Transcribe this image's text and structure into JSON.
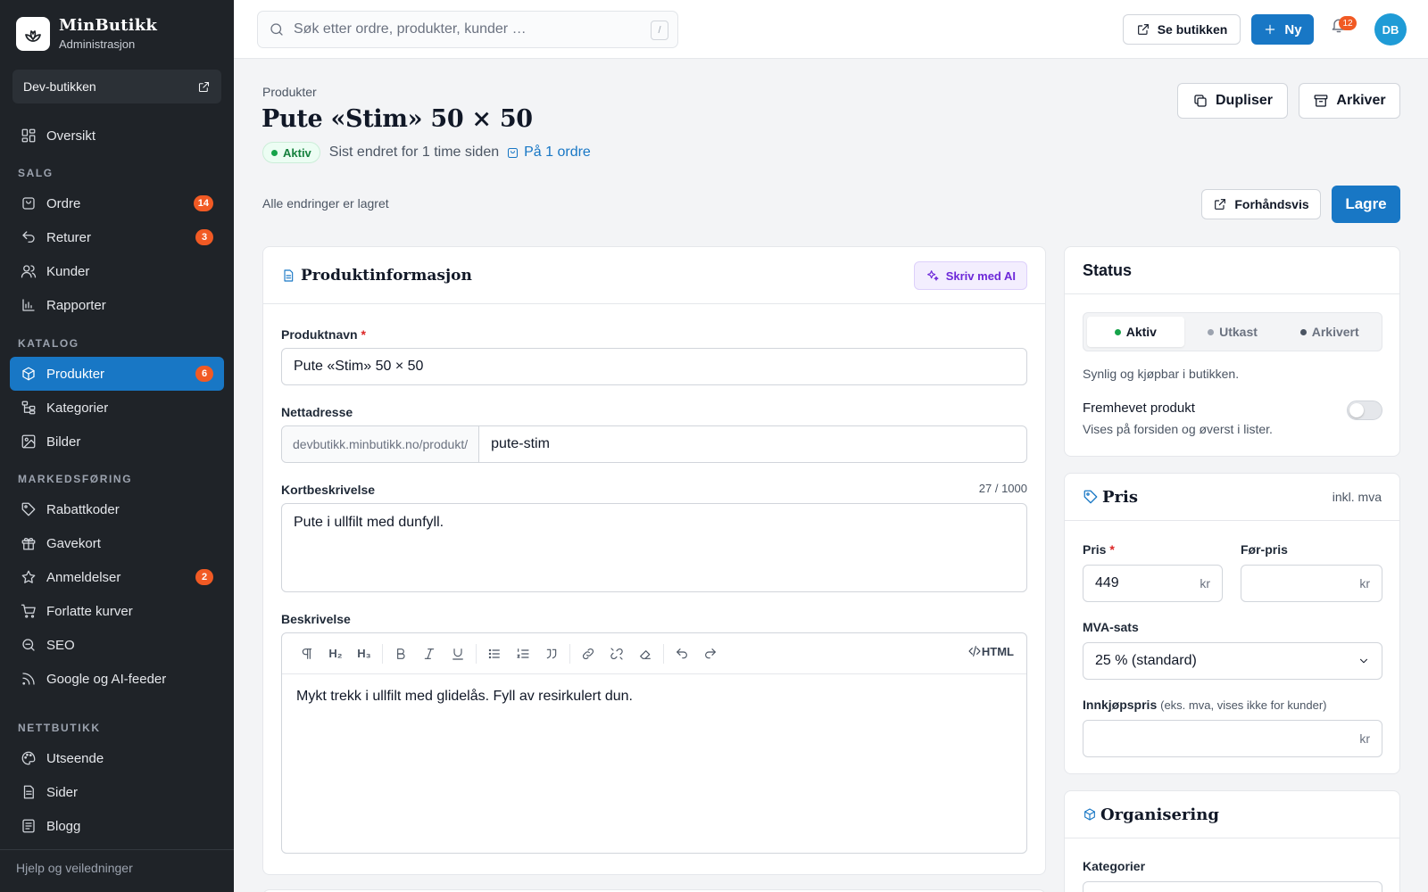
{
  "brand": {
    "name": "MinButikk",
    "subtitle": "Administrasjon"
  },
  "store": {
    "name": "Dev-butikken"
  },
  "nav": {
    "overview": "Oversikt",
    "sections": [
      {
        "heading": "SALG",
        "items": [
          {
            "label": "Ordre",
            "icon": "bag-icon",
            "badge": "14"
          },
          {
            "label": "Returer",
            "icon": "return-icon",
            "badge": "3"
          },
          {
            "label": "Kunder",
            "icon": "users-icon",
            "badge": ""
          },
          {
            "label": "Rapporter",
            "icon": "chart-icon",
            "badge": ""
          }
        ]
      },
      {
        "heading": "KATALOG",
        "items": [
          {
            "label": "Produkter",
            "icon": "box-icon",
            "badge": "6",
            "active": true
          },
          {
            "label": "Kategorier",
            "icon": "tree-icon",
            "badge": ""
          },
          {
            "label": "Bilder",
            "icon": "image-icon",
            "badge": ""
          }
        ]
      },
      {
        "heading": "MARKEDSFØRING",
        "items": [
          {
            "label": "Rabattkoder",
            "icon": "tag-icon",
            "badge": ""
          },
          {
            "label": "Gavekort",
            "icon": "gift-icon",
            "badge": ""
          },
          {
            "label": "Anmeldelser",
            "icon": "star-icon",
            "badge": "2"
          },
          {
            "label": "Forlatte kurver",
            "icon": "cart-icon",
            "badge": ""
          },
          {
            "label": "SEO",
            "icon": "search-icon",
            "badge": ""
          },
          {
            "label": "Google og AI-feeder",
            "icon": "rss-icon",
            "badge": ""
          }
        ]
      },
      {
        "heading": "NETTBUTIKK",
        "items": [
          {
            "label": "Utseende",
            "icon": "palette-icon",
            "badge": ""
          },
          {
            "label": "Sider",
            "icon": "page-icon",
            "badge": ""
          },
          {
            "label": "Blogg",
            "icon": "blog-icon",
            "badge": ""
          }
        ]
      }
    ],
    "help": "Hjelp og veiledninger"
  },
  "topbar": {
    "search_placeholder": "Søk etter ordre, produkter, kunder …",
    "shortcut": "/",
    "view_store": "Se butikken",
    "new": "Ny",
    "notifications": "12",
    "avatar": "DB"
  },
  "page": {
    "breadcrumb": "Produkter",
    "title": "Pute «Stim» 50 × 50",
    "status": "Aktiv",
    "last_edited": "Sist endret for 1 time siden",
    "orders_link": "På 1 ordre",
    "duplicate": "Dupliser",
    "archive": "Arkiver",
    "saved_note": "Alle endringer er lagret",
    "preview": "Forhåndsvis",
    "save": "Lagre"
  },
  "product_info": {
    "title": "Produktinformasjon",
    "ai_button": "Skriv med AI",
    "name_label": "Produktnavn",
    "name_value": "Pute «Stim» 50 × 50",
    "url_label": "Nettadresse",
    "url_prefix": "devbutikk.minbutikk.no/produkt/",
    "url_slug": "pute-stim",
    "short_label": "Kortbeskrivelse",
    "short_counter": "27 / 1000",
    "short_value": "Pute i ullfilt med dunfyll.",
    "desc_label": "Beskrivelse",
    "toolbar": {
      "h2": "H₂",
      "h3": "H₃",
      "html": "HTML"
    },
    "desc_value": "Mykt trekk i ullfilt med glidelås. Fyll av resirkulert dun."
  },
  "status_card": {
    "title": "Status",
    "options": [
      "Aktiv",
      "Utkast",
      "Arkivert"
    ],
    "option_colors": [
      "#16a34a",
      "#9ca3af",
      "#4b5563"
    ],
    "selected": "Aktiv",
    "help": "Synlig og kjøpbar i butikken.",
    "featured_label": "Fremhevet produkt",
    "featured_help": "Vises på forsiden og øverst i lister.",
    "featured_on": false
  },
  "price_card": {
    "title": "Pris",
    "note": "inkl. mva",
    "price_label": "Pris",
    "price_value": "449",
    "currency": "kr",
    "compare_label": "Før-pris",
    "compare_value": "",
    "vat_label": "MVA-sats",
    "vat_value": "25 % (standard)",
    "cost_label": "Innkjøpspris",
    "cost_note": "(eks. mva, vises ikke for kunder)",
    "cost_value": ""
  },
  "org_card": {
    "title": "Organisering",
    "categories_label": "Kategorier"
  },
  "colors": {
    "accent": "#1877c5",
    "sidebar": "#1f2328",
    "badge": "#f15a24",
    "ai": "#6d28d9"
  }
}
